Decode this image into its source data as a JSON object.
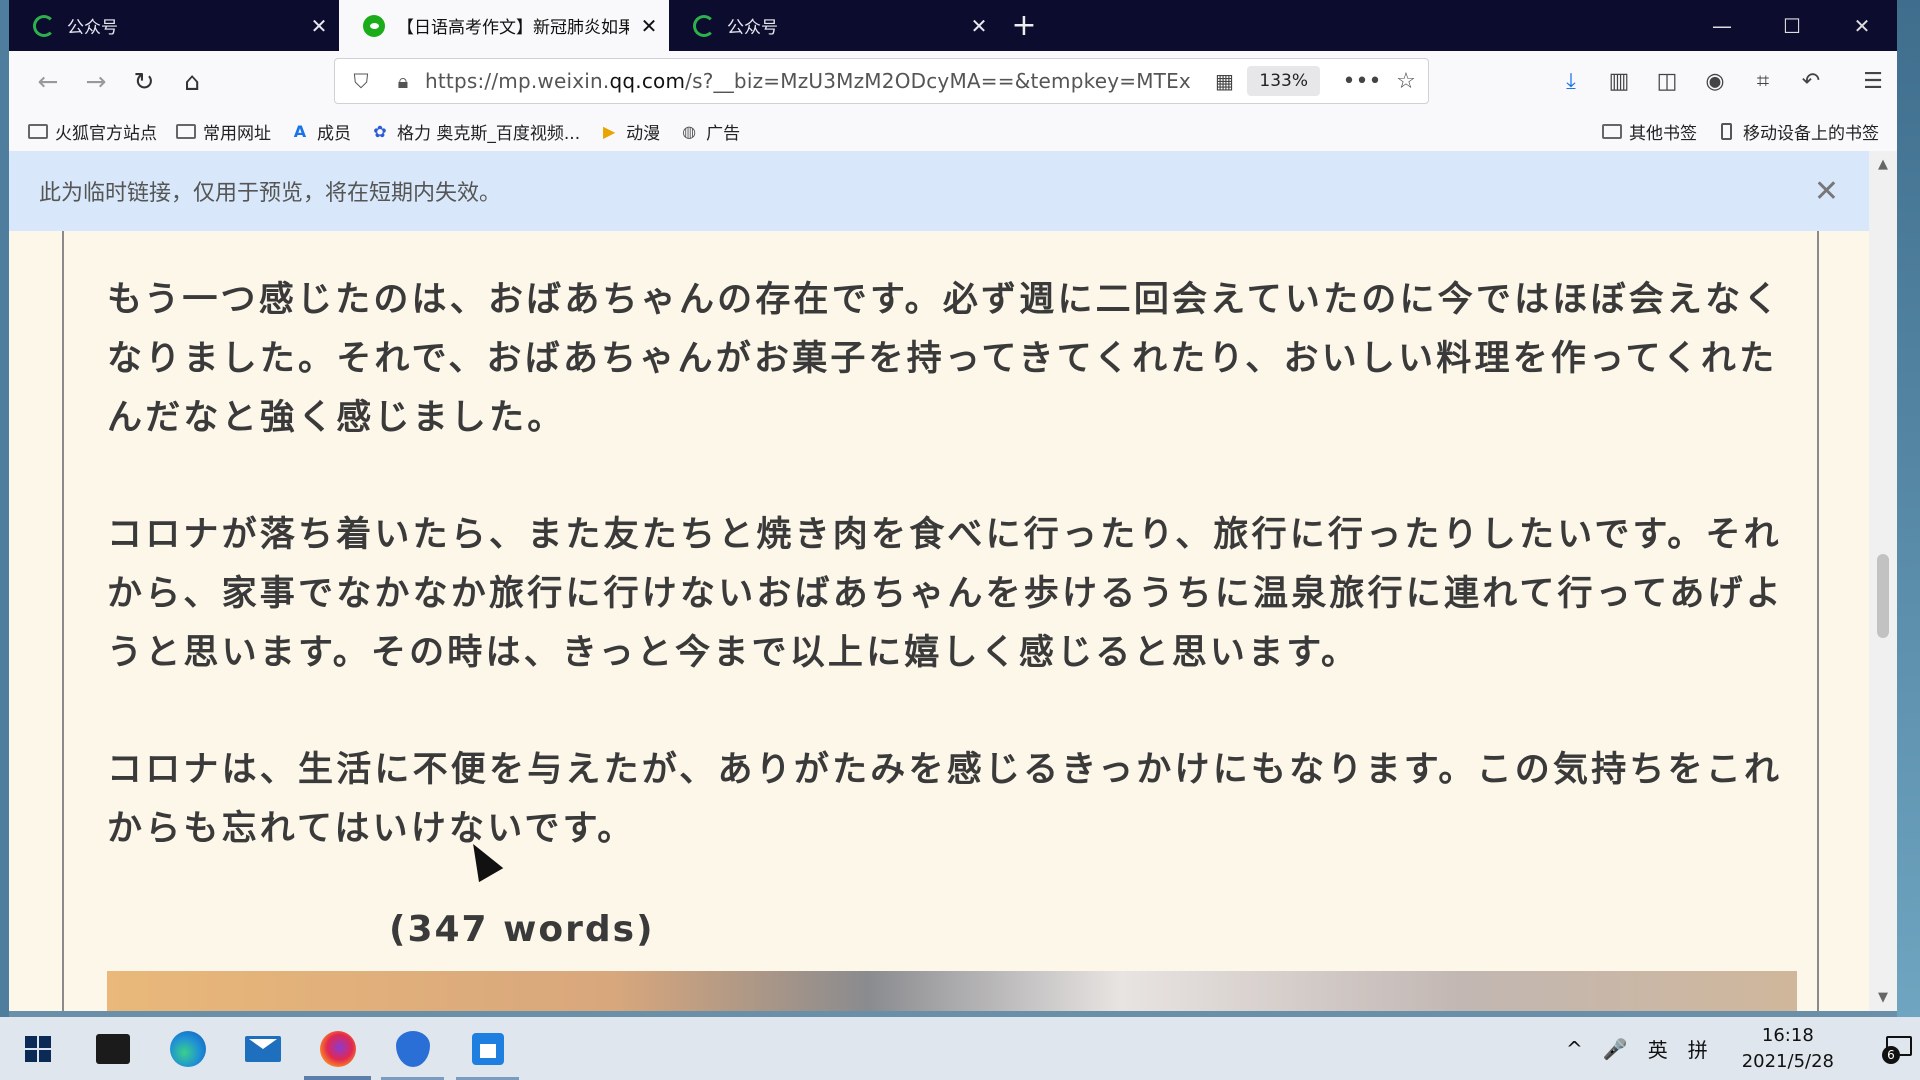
{
  "tabs": [
    {
      "title": "公众号",
      "active": false,
      "icon": "qq-icon"
    },
    {
      "title": "【日语高考作文】新冠肺炎如果",
      "active": true,
      "icon": "wechat-icon"
    },
    {
      "title": "公众号",
      "active": false,
      "icon": "qq-icon"
    }
  ],
  "window_controls": {
    "minimize": "—",
    "maximize": "☐",
    "close": "✕"
  },
  "nav": {
    "back": "←",
    "forward": "→",
    "reload": "↻",
    "home": "⌂",
    "url_prefix": "https://mp.weixin.",
    "url_domain": "qq.com",
    "url_suffix": "/s?__biz=MzU3MzM2ODcyMA==&tempkey=MTEx",
    "zoom": "133%",
    "more": "•••",
    "bookmark_star": "☆"
  },
  "bookmarks": {
    "items": [
      {
        "label": "火狐官方站点",
        "icon": "folder-icon"
      },
      {
        "label": "常用网址",
        "icon": "folder-icon"
      },
      {
        "label": "成员",
        "icon": "translate-icon"
      },
      {
        "label": "格力 奥克斯_百度视频...",
        "icon": "baidu-paw-icon"
      },
      {
        "label": "动漫",
        "icon": "play-icon"
      },
      {
        "label": "广告",
        "icon": "globe-icon"
      }
    ],
    "other": "其他书签",
    "mobile": "移动设备上的书签"
  },
  "notice": {
    "message": "此为临时链接，仅用于预览，将在短期内失效。",
    "close": "✕"
  },
  "article": {
    "paragraphs": [
      "もう一つ感じたのは、おばあちゃんの存在です。必ず週に二回会えていたのに今ではほぼ会えなくなりました。それで、おばあちゃんがお菓子を持ってきてくれたり、おいしい料理を作ってくれたんだなと強く感じました。",
      "コロナが落ち着いたら、また友たちと焼き肉を食べに行ったり、旅行に行ったりしたいです。それから、家事でなかなか旅行に行けないおばあちゃんを歩けるうちに温泉旅行に連れて行ってあげようと思います。その時は、きっと今まで以上に嬉しく感じると思います。",
      "コロナは、生活に不便を与えたが、ありがたみを感じるきっかけにもなります。この気持ちをこれからも忘れてはいけないです。"
    ],
    "word_count": "(347 words)"
  },
  "taskbar": {
    "apps": [
      "windows-start-icon",
      "store-icon",
      "edge-icon",
      "mail-icon",
      "firefox-icon",
      "shield-app-icon",
      "calendar-app-icon"
    ],
    "tray_chevron": "^",
    "mic": "🎤",
    "ime_lang": "英",
    "ime_mode": "拼",
    "time": "16:18",
    "date": "2021/5/28",
    "notification_count": "6"
  }
}
